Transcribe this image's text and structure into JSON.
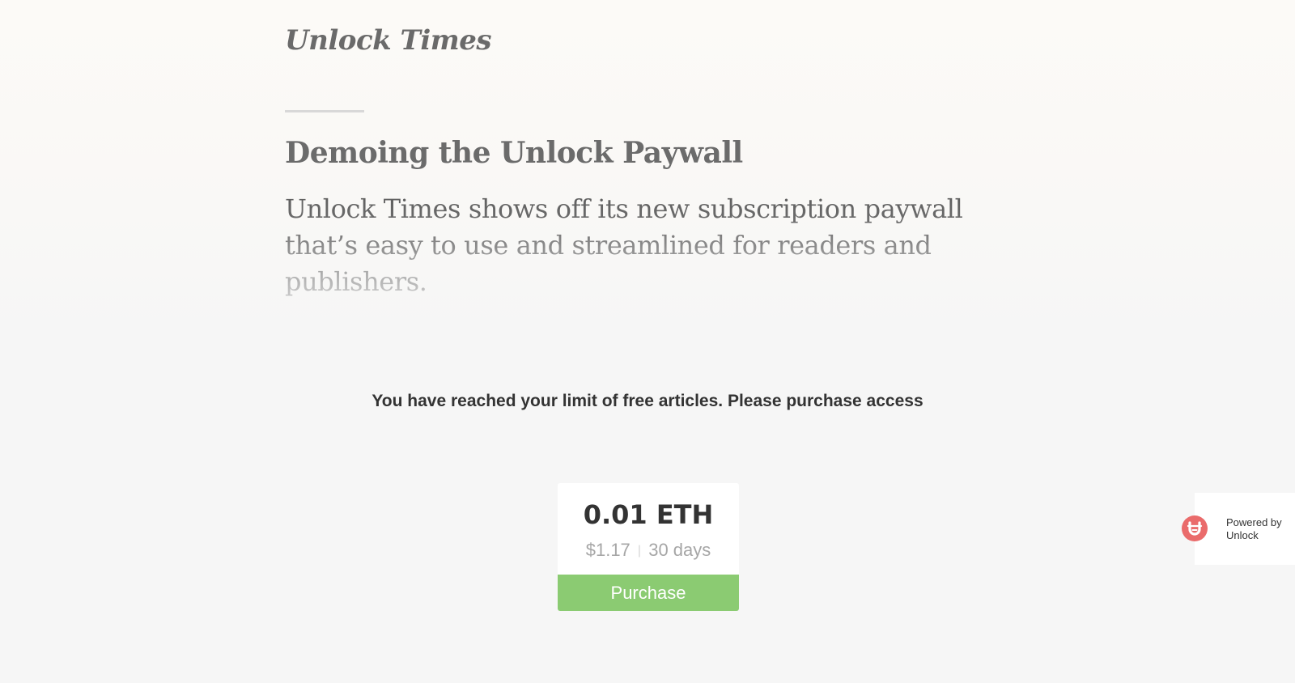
{
  "masthead": {
    "title": "Unlock Times"
  },
  "article": {
    "headline": "Demoing the Unlock Paywall",
    "lede": "Unlock Times shows off its new subscription paywall that’s easy to use and streamlined for readers and publishers."
  },
  "paywall": {
    "message": "You have reached your limit of free articles. Please purchase access",
    "offer": {
      "price_eth": "0.01 ETH",
      "price_usd": "$1.17",
      "separator": "|",
      "duration": "30 days",
      "purchase_label": "Purchase"
    }
  },
  "badge": {
    "line1": "Powered by",
    "line2": "Unlock",
    "icon": "unlock-logo-icon"
  },
  "colors": {
    "accent_green": "#8bcb72",
    "brand_red": "#ea6b6b",
    "text_dark": "#333333",
    "text_muted": "#a6a6a6"
  }
}
